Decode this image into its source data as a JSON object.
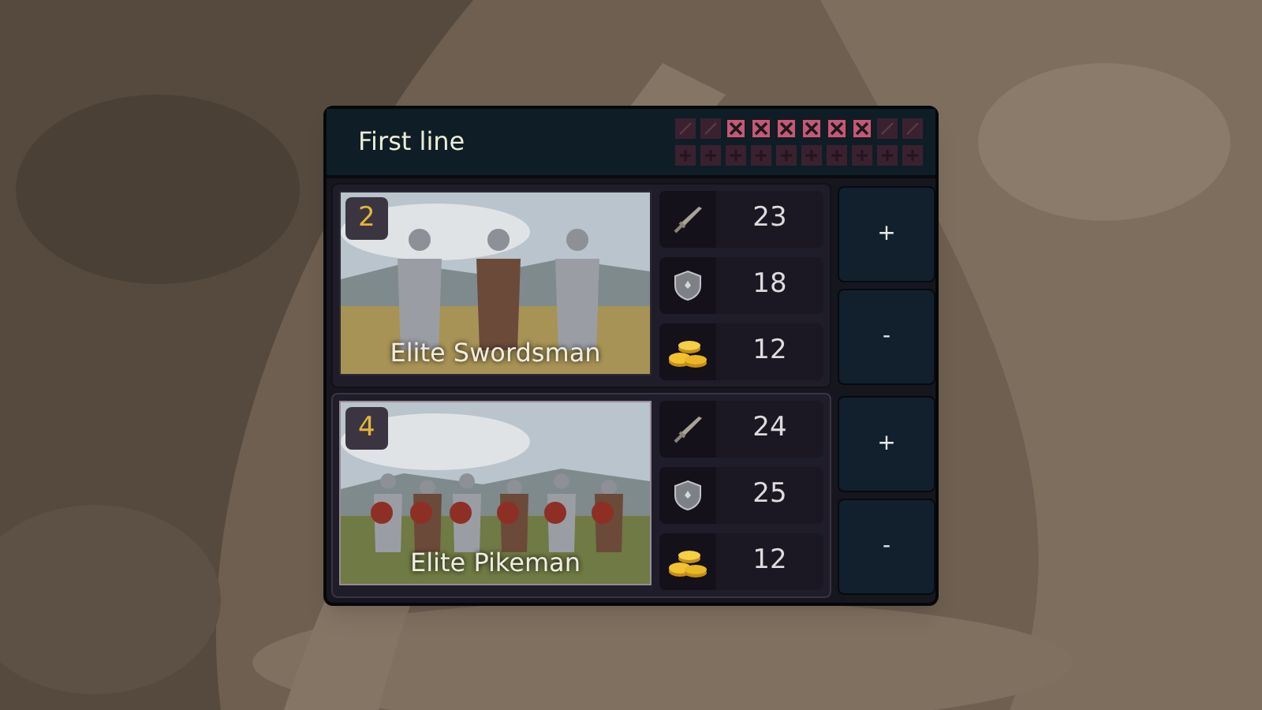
{
  "panel": {
    "title": "First line",
    "slot_rows": [
      {
        "slots": [
          {
            "kind": "blocked"
          },
          {
            "kind": "blocked"
          },
          {
            "kind": "filled"
          },
          {
            "kind": "filled"
          },
          {
            "kind": "filled"
          },
          {
            "kind": "filled"
          },
          {
            "kind": "filled"
          },
          {
            "kind": "filled"
          },
          {
            "kind": "blocked"
          },
          {
            "kind": "blocked"
          }
        ]
      },
      {
        "slots": [
          {
            "kind": "open"
          },
          {
            "kind": "open"
          },
          {
            "kind": "open"
          },
          {
            "kind": "open"
          },
          {
            "kind": "open"
          },
          {
            "kind": "open"
          },
          {
            "kind": "open"
          },
          {
            "kind": "open"
          },
          {
            "kind": "open"
          },
          {
            "kind": "open"
          }
        ]
      }
    ]
  },
  "units": [
    {
      "name": "Elite Swordsman",
      "count": "2",
      "selected": false,
      "attack": "23",
      "defense": "18",
      "cost": "12",
      "add": "+",
      "remove": "-"
    },
    {
      "name": "Elite Pikeman",
      "count": "4",
      "selected": true,
      "attack": "24",
      "defense": "25",
      "cost": "12",
      "add": "+",
      "remove": "-"
    }
  ]
}
